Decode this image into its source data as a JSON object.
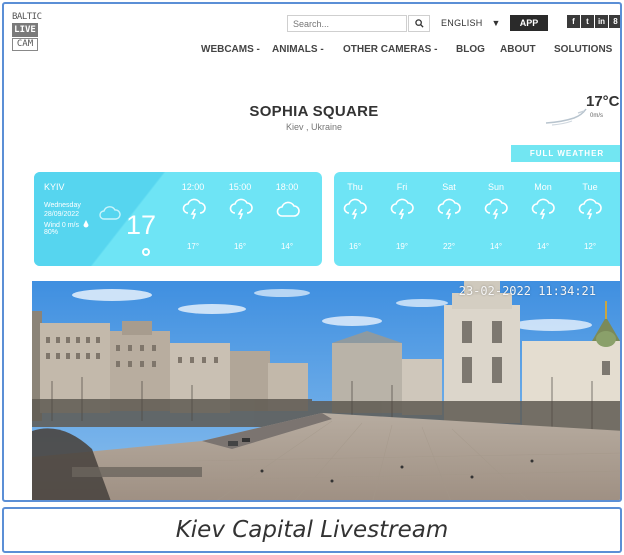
{
  "logo": {
    "line1": "BALTIC",
    "line2": "LIVE",
    "line3": "CAM"
  },
  "search": {
    "placeholder": "Search..."
  },
  "language": "ENGLISH",
  "app_label": "APP",
  "social": [
    {
      "label": "f",
      "icon": "facebook-icon"
    },
    {
      "label": "t",
      "icon": "twitter-icon"
    },
    {
      "label": "in",
      "icon": "linkedin-icon"
    },
    {
      "label": "8",
      "icon": "google-plus-icon"
    }
  ],
  "nav": [
    {
      "label": "WEBCAMS -"
    },
    {
      "label": "ANIMALS -"
    },
    {
      "label": "OTHER CAMERAS -"
    },
    {
      "label": "BLOG"
    },
    {
      "label": "ABOUT"
    },
    {
      "label": "SOLUTIONS"
    }
  ],
  "location": {
    "title": "SOPHIA SQUARE",
    "subtitle": "Kiev , Ukraine"
  },
  "current": {
    "temp": "17°C",
    "wind": "0m/s"
  },
  "full_weather_label": "FULL WEATHER",
  "today": {
    "city": "KYIV",
    "day": "Wednesday",
    "date": "28/09/2022",
    "wind": "Wind 0 m/s",
    "humidity": "80%",
    "temp": "17",
    "hours": [
      {
        "time": "12:00",
        "temp": "17°",
        "icon": "thunder-cloud-icon"
      },
      {
        "time": "15:00",
        "temp": "16°",
        "icon": "thunder-cloud-icon"
      },
      {
        "time": "18:00",
        "temp": "14°",
        "icon": "cloud-icon"
      }
    ]
  },
  "forecast": [
    {
      "day": "Thu",
      "temp": "16°",
      "icon": "thunder-cloud-icon"
    },
    {
      "day": "Fri",
      "temp": "19°",
      "icon": "thunder-cloud-icon"
    },
    {
      "day": "Sat",
      "temp": "22°",
      "icon": "thunder-cloud-icon"
    },
    {
      "day": "Sun",
      "temp": "14°",
      "icon": "thunder-cloud-icon"
    },
    {
      "day": "Mon",
      "temp": "14°",
      "icon": "thunder-cloud-icon"
    },
    {
      "day": "Tue",
      "temp": "12°",
      "icon": "thunder-cloud-icon"
    }
  ],
  "webcam": {
    "timestamp": "23-02-2022 11:34:21"
  },
  "caption": "Kiev Capital Livestream",
  "colors": {
    "accent": "#6ee4f5",
    "frame_border": "#5b8fd6",
    "dark_button": "#2a2a2a"
  }
}
